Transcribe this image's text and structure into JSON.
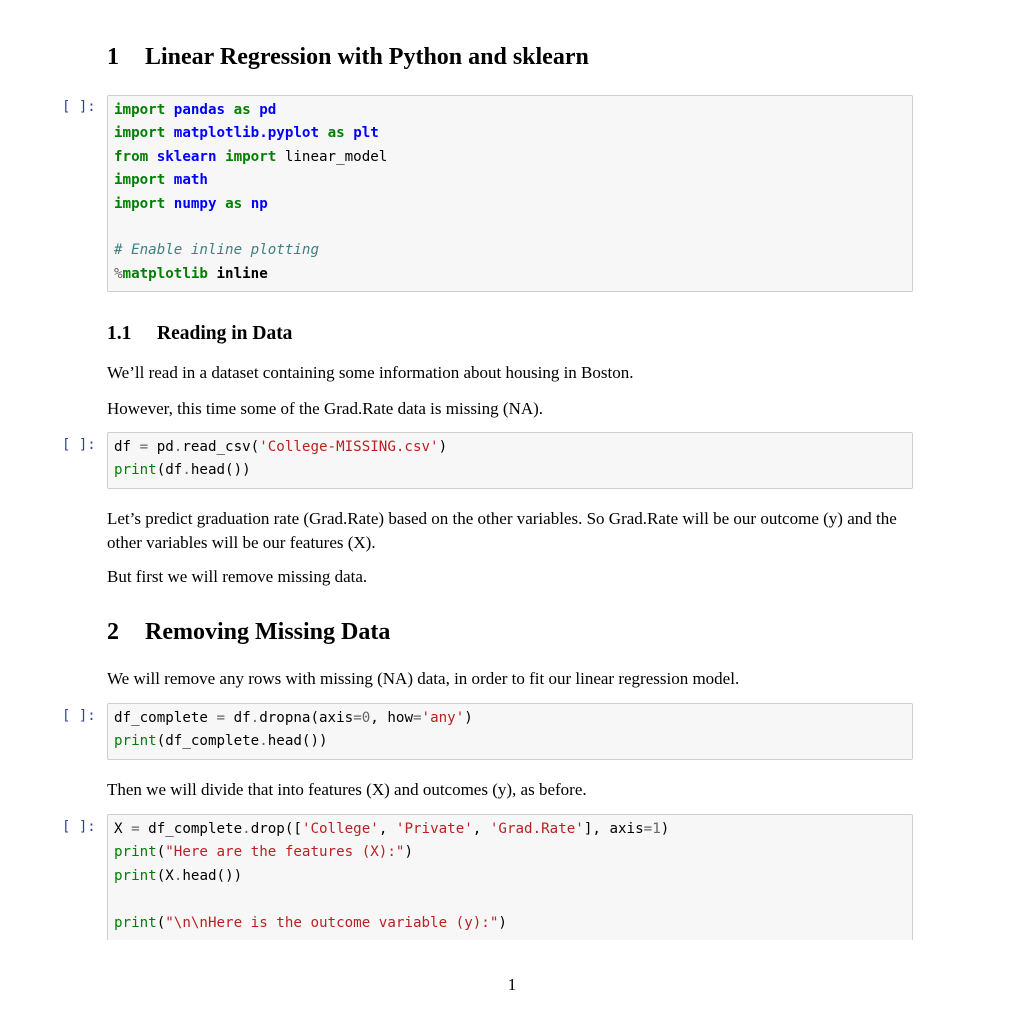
{
  "sections": {
    "s1": {
      "number": "1",
      "title": "Linear Regression with Python and sklearn"
    },
    "s1_1": {
      "number": "1.1",
      "title": "Reading in Data"
    },
    "s2": {
      "number": "2",
      "title": "Removing Missing Data"
    }
  },
  "paragraphs": {
    "p1": "We’ll read in a dataset containing some information about housing in Boston.",
    "p2": "However, this time some of the Grad.Rate data is missing (NA).",
    "p3": "Let’s predict graduation rate (Grad.Rate) based on the other variables. So Grad.Rate will be our outcome (y) and the other variables will be our features (X).",
    "p4": "But first we will remove missing data.",
    "p5": "We will remove any rows with missing (NA) data, in order to fit our linear regression model.",
    "p6": "Then we will divide that into features (X) and outcomes (y), as before."
  },
  "cells": [
    {
      "prompt": "[ ]:",
      "lines": [
        [
          {
            "t": "import",
            "k": "kw"
          },
          {
            "t": " "
          },
          {
            "t": "pandas",
            "k": "nn"
          },
          {
            "t": " "
          },
          {
            "t": "as",
            "k": "kw"
          },
          {
            "t": " "
          },
          {
            "t": "pd",
            "k": "nn"
          }
        ],
        [
          {
            "t": "import",
            "k": "kw"
          },
          {
            "t": " "
          },
          {
            "t": "matplotlib.pyplot",
            "k": "nn"
          },
          {
            "t": " "
          },
          {
            "t": "as",
            "k": "kw"
          },
          {
            "t": " "
          },
          {
            "t": "plt",
            "k": "nn"
          }
        ],
        [
          {
            "t": "from",
            "k": "kw"
          },
          {
            "t": " "
          },
          {
            "t": "sklearn",
            "k": "nn"
          },
          {
            "t": " "
          },
          {
            "t": "import",
            "k": "kw"
          },
          {
            "t": " linear_model"
          }
        ],
        [
          {
            "t": "import",
            "k": "kw"
          },
          {
            "t": " "
          },
          {
            "t": "math",
            "k": "nn"
          }
        ],
        [
          {
            "t": "import",
            "k": "kw"
          },
          {
            "t": " "
          },
          {
            "t": "numpy",
            "k": "nn"
          },
          {
            "t": " "
          },
          {
            "t": "as",
            "k": "kw"
          },
          {
            "t": " "
          },
          {
            "t": "np",
            "k": "nn"
          }
        ],
        [],
        [
          {
            "t": "# Enable inline plotting",
            "k": "c"
          }
        ],
        [
          {
            "t": "%",
            "k": "o"
          },
          {
            "t": "matplotlib",
            "k": "kw"
          },
          {
            "t": " inline",
            "k": "bold"
          }
        ]
      ]
    },
    {
      "prompt": "[ ]:",
      "lines": [
        [
          {
            "t": "df "
          },
          {
            "t": "=",
            "k": "o"
          },
          {
            "t": " pd"
          },
          {
            "t": ".",
            "k": "o"
          },
          {
            "t": "read_csv("
          },
          {
            "t": "'College-MISSING.csv'",
            "k": "s"
          },
          {
            "t": ")"
          }
        ],
        [
          {
            "t": "print",
            "k": "nb"
          },
          {
            "t": "(df"
          },
          {
            "t": ".",
            "k": "o"
          },
          {
            "t": "head())"
          }
        ]
      ]
    },
    {
      "prompt": "[ ]:",
      "lines": [
        [
          {
            "t": "df_complete "
          },
          {
            "t": "=",
            "k": "o"
          },
          {
            "t": " df"
          },
          {
            "t": ".",
            "k": "o"
          },
          {
            "t": "dropna(axis"
          },
          {
            "t": "=",
            "k": "o"
          },
          {
            "t": "0",
            "k": "mi"
          },
          {
            "t": ", how"
          },
          {
            "t": "=",
            "k": "o"
          },
          {
            "t": "'any'",
            "k": "s"
          },
          {
            "t": ")"
          }
        ],
        [
          {
            "t": "print",
            "k": "nb"
          },
          {
            "t": "(df_complete"
          },
          {
            "t": ".",
            "k": "o"
          },
          {
            "t": "head())"
          }
        ]
      ]
    },
    {
      "prompt": "[ ]:",
      "lines": [
        [
          {
            "t": "X "
          },
          {
            "t": "=",
            "k": "o"
          },
          {
            "t": " df_complete"
          },
          {
            "t": ".",
            "k": "o"
          },
          {
            "t": "drop(["
          },
          {
            "t": "'College'",
            "k": "s"
          },
          {
            "t": ", "
          },
          {
            "t": "'Private'",
            "k": "s"
          },
          {
            "t": ", "
          },
          {
            "t": "'Grad.Rate'",
            "k": "s"
          },
          {
            "t": "], axis"
          },
          {
            "t": "=",
            "k": "o"
          },
          {
            "t": "1",
            "k": "mi"
          },
          {
            "t": ")"
          }
        ],
        [
          {
            "t": "print",
            "k": "nb"
          },
          {
            "t": "("
          },
          {
            "t": "\"Here are the features (X):\"",
            "k": "s"
          },
          {
            "t": ")"
          }
        ],
        [
          {
            "t": "print",
            "k": "nb"
          },
          {
            "t": "(X"
          },
          {
            "t": ".",
            "k": "o"
          },
          {
            "t": "head())"
          }
        ],
        [],
        [
          {
            "t": "print",
            "k": "nb"
          },
          {
            "t": "("
          },
          {
            "t": "\"\\n\\nHere is the outcome variable (y):\"",
            "k": "s"
          },
          {
            "t": ")"
          }
        ]
      ]
    }
  ],
  "footer": {
    "page_number": "1"
  }
}
